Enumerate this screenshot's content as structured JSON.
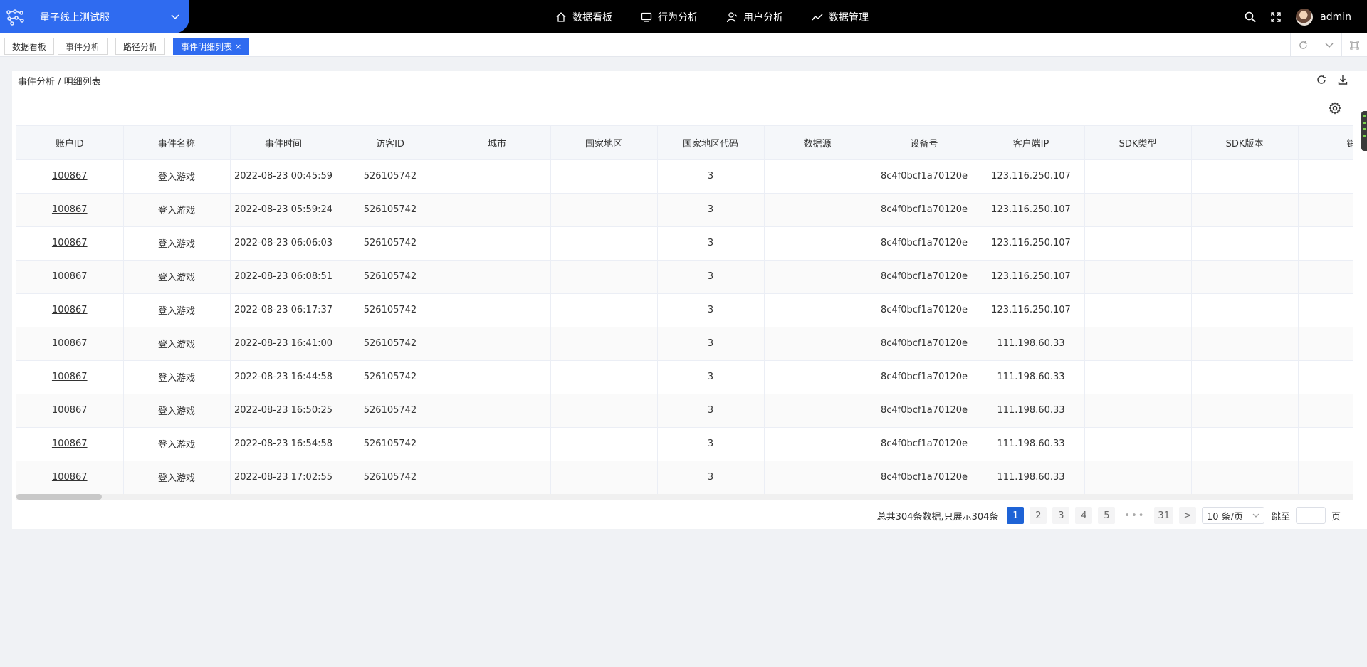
{
  "app": {
    "name": "量子线上测试服"
  },
  "topnav": [
    {
      "label": "数据看板",
      "icon": "home-icon"
    },
    {
      "label": "行为分析",
      "icon": "monitor-icon"
    },
    {
      "label": "用户分析",
      "icon": "user-icon"
    },
    {
      "label": "数据管理",
      "icon": "trend-icon"
    }
  ],
  "user": {
    "name": "admin"
  },
  "tabs": [
    {
      "label": "数据看板"
    },
    {
      "label": "事件分析"
    },
    {
      "label": "路径分析"
    },
    {
      "label": "事件明细列表",
      "close": "×"
    }
  ],
  "breadcrumb": "事件分析 / 明细列表",
  "table": {
    "headers": [
      "账户ID",
      "事件名称",
      "事件时间",
      "访客ID",
      "城市",
      "国家地区",
      "国家地区代码",
      "数据源",
      "设备号",
      "客户端IP",
      "SDK类型",
      "SDK版本",
      "销"
    ],
    "rows": [
      [
        "100867",
        "登入游戏",
        "2022-08-23 00:45:59",
        "526105742",
        "",
        "",
        "3",
        "",
        "8c4f0bcf1a70120e",
        "123.116.250.107",
        "",
        "",
        ""
      ],
      [
        "100867",
        "登入游戏",
        "2022-08-23 05:59:24",
        "526105742",
        "",
        "",
        "3",
        "",
        "8c4f0bcf1a70120e",
        "123.116.250.107",
        "",
        "",
        ""
      ],
      [
        "100867",
        "登入游戏",
        "2022-08-23 06:06:03",
        "526105742",
        "",
        "",
        "3",
        "",
        "8c4f0bcf1a70120e",
        "123.116.250.107",
        "",
        "",
        ""
      ],
      [
        "100867",
        "登入游戏",
        "2022-08-23 06:08:51",
        "526105742",
        "",
        "",
        "3",
        "",
        "8c4f0bcf1a70120e",
        "123.116.250.107",
        "",
        "",
        ""
      ],
      [
        "100867",
        "登入游戏",
        "2022-08-23 06:17:37",
        "526105742",
        "",
        "",
        "3",
        "",
        "8c4f0bcf1a70120e",
        "123.116.250.107",
        "",
        "",
        ""
      ],
      [
        "100867",
        "登入游戏",
        "2022-08-23 16:41:00",
        "526105742",
        "",
        "",
        "3",
        "",
        "8c4f0bcf1a70120e",
        "111.198.60.33",
        "",
        "",
        ""
      ],
      [
        "100867",
        "登入游戏",
        "2022-08-23 16:44:58",
        "526105742",
        "",
        "",
        "3",
        "",
        "8c4f0bcf1a70120e",
        "111.198.60.33",
        "",
        "",
        ""
      ],
      [
        "100867",
        "登入游戏",
        "2022-08-23 16:50:25",
        "526105742",
        "",
        "",
        "3",
        "",
        "8c4f0bcf1a70120e",
        "111.198.60.33",
        "",
        "",
        ""
      ],
      [
        "100867",
        "登入游戏",
        "2022-08-23 16:54:58",
        "526105742",
        "",
        "",
        "3",
        "",
        "8c4f0bcf1a70120e",
        "111.198.60.33",
        "",
        "",
        ""
      ],
      [
        "100867",
        "登入游戏",
        "2022-08-23 17:02:55",
        "526105742",
        "",
        "",
        "3",
        "",
        "8c4f0bcf1a70120e",
        "111.198.60.33",
        "",
        "",
        ""
      ]
    ]
  },
  "pagination": {
    "total_text": "总共304条数据,只展示304条",
    "pages": [
      "1",
      "2",
      "3",
      "4",
      "5"
    ],
    "ellipsis": "•••",
    "last_page": "31",
    "next": ">",
    "page_size": "10 条/页",
    "jump_label": "跳至",
    "page_suffix": "页"
  },
  "colors": {
    "accent": "#2f6bf0",
    "topbar": "#000000",
    "active_page": "#1e63d6"
  }
}
